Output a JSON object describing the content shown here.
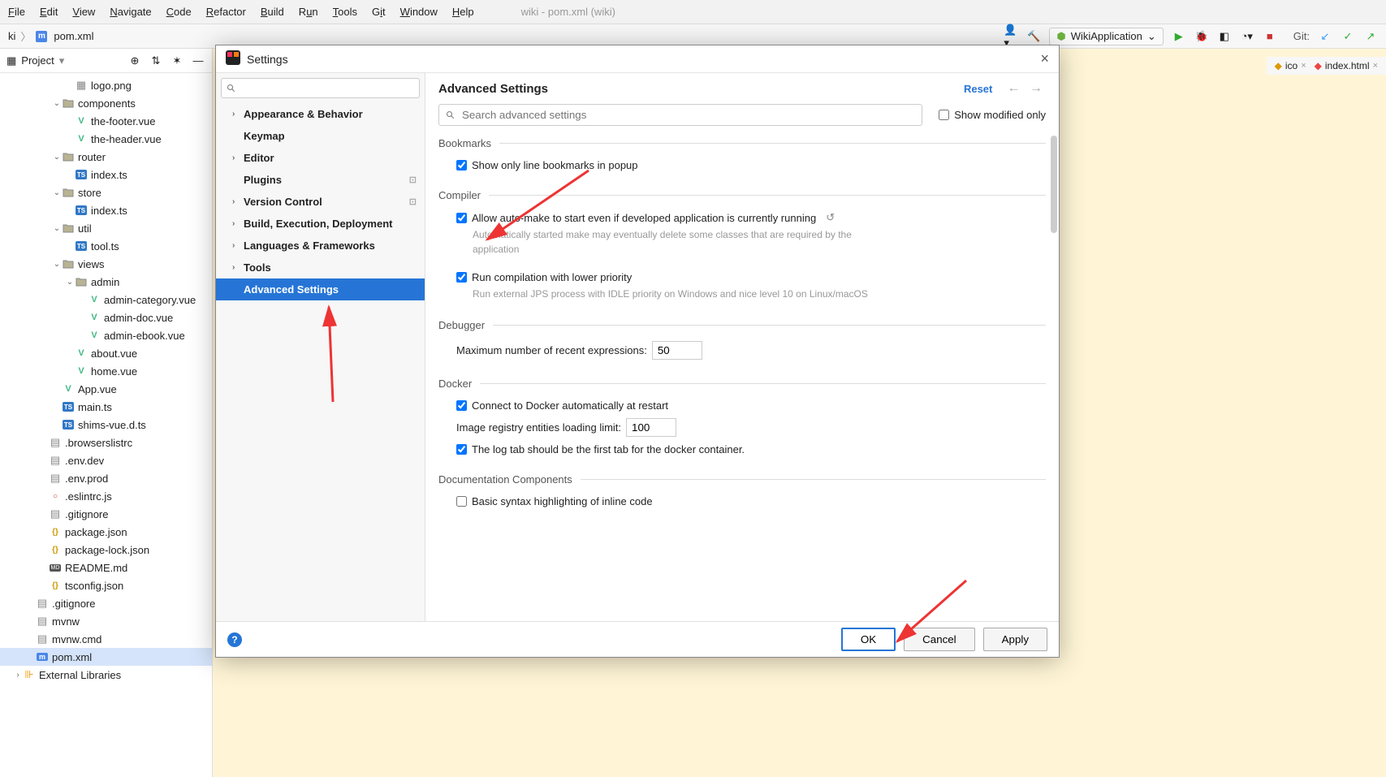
{
  "menubar": {
    "items": [
      "File",
      "Edit",
      "View",
      "Navigate",
      "Code",
      "Refactor",
      "Build",
      "Run",
      "Tools",
      "Git",
      "Window",
      "Help"
    ],
    "title_hint": "wiki - pom.xml (wiki)"
  },
  "breadcrumb": {
    "parts": [
      "ki",
      "pom.xml"
    ]
  },
  "run_config": "WikiApplication",
  "git_label": "Git:",
  "project_panel": {
    "title": "Project",
    "nodes": [
      {
        "depth": 5,
        "icon": "image",
        "label": "logo.png",
        "expand": ""
      },
      {
        "depth": 4,
        "icon": "folder",
        "label": "components",
        "expand": "v"
      },
      {
        "depth": 5,
        "icon": "vue",
        "label": "the-footer.vue",
        "expand": ""
      },
      {
        "depth": 5,
        "icon": "vue",
        "label": "the-header.vue",
        "expand": ""
      },
      {
        "depth": 4,
        "icon": "folder",
        "label": "router",
        "expand": "v"
      },
      {
        "depth": 5,
        "icon": "ts",
        "label": "index.ts",
        "expand": ""
      },
      {
        "depth": 4,
        "icon": "folder",
        "label": "store",
        "expand": "v"
      },
      {
        "depth": 5,
        "icon": "ts",
        "label": "index.ts",
        "expand": ""
      },
      {
        "depth": 4,
        "icon": "folder",
        "label": "util",
        "expand": "v"
      },
      {
        "depth": 5,
        "icon": "ts",
        "label": "tool.ts",
        "expand": ""
      },
      {
        "depth": 4,
        "icon": "folder",
        "label": "views",
        "expand": "v"
      },
      {
        "depth": 5,
        "icon": "folder",
        "label": "admin",
        "expand": "v"
      },
      {
        "depth": 6,
        "icon": "vue",
        "label": "admin-category.vue",
        "expand": ""
      },
      {
        "depth": 6,
        "icon": "vue",
        "label": "admin-doc.vue",
        "expand": ""
      },
      {
        "depth": 6,
        "icon": "vue",
        "label": "admin-ebook.vue",
        "expand": ""
      },
      {
        "depth": 5,
        "icon": "vue",
        "label": "about.vue",
        "expand": ""
      },
      {
        "depth": 5,
        "icon": "vue",
        "label": "home.vue",
        "expand": ""
      },
      {
        "depth": 4,
        "icon": "vue",
        "label": "App.vue",
        "expand": ""
      },
      {
        "depth": 4,
        "icon": "ts",
        "label": "main.ts",
        "expand": ""
      },
      {
        "depth": 4,
        "icon": "ts",
        "label": "shims-vue.d.ts",
        "expand": ""
      },
      {
        "depth": 3,
        "icon": "file",
        "label": ".browserslistrc",
        "expand": ""
      },
      {
        "depth": 3,
        "icon": "file",
        "label": ".env.dev",
        "expand": ""
      },
      {
        "depth": 3,
        "icon": "file",
        "label": ".env.prod",
        "expand": ""
      },
      {
        "depth": 3,
        "icon": "js",
        "label": ".eslintrc.js",
        "expand": ""
      },
      {
        "depth": 3,
        "icon": "file",
        "label": ".gitignore",
        "expand": ""
      },
      {
        "depth": 3,
        "icon": "json",
        "label": "package.json",
        "expand": ""
      },
      {
        "depth": 3,
        "icon": "json",
        "label": "package-lock.json",
        "expand": ""
      },
      {
        "depth": 3,
        "icon": "md",
        "label": "README.md",
        "expand": ""
      },
      {
        "depth": 3,
        "icon": "json",
        "label": "tsconfig.json",
        "expand": ""
      },
      {
        "depth": 2,
        "icon": "file",
        "label": ".gitignore",
        "expand": ""
      },
      {
        "depth": 2,
        "icon": "file",
        "label": "mvnw",
        "expand": ""
      },
      {
        "depth": 2,
        "icon": "file",
        "label": "mvnw.cmd",
        "expand": ""
      },
      {
        "depth": 2,
        "icon": "maven",
        "label": "pom.xml",
        "expand": "",
        "selected": true
      },
      {
        "depth": 1,
        "icon": "lib",
        "label": "External Libraries",
        "expand": ">"
      }
    ]
  },
  "editor_tabs": [
    {
      "icon": "ico",
      "label": "ico"
    },
    {
      "icon": "html",
      "label": "index.html"
    }
  ],
  "dialog": {
    "title": "Settings",
    "search_placeholder": "",
    "nav": [
      {
        "label": "Appearance & Behavior",
        "bold": true,
        "chev": true
      },
      {
        "label": "Keymap",
        "bold": true,
        "chev": false
      },
      {
        "label": "Editor",
        "bold": true,
        "chev": true
      },
      {
        "label": "Plugins",
        "bold": true,
        "chev": false,
        "badge": "⊡"
      },
      {
        "label": "Version Control",
        "bold": true,
        "chev": true,
        "badge": "⊡"
      },
      {
        "label": "Build, Execution, Deployment",
        "bold": true,
        "chev": true
      },
      {
        "label": "Languages & Frameworks",
        "bold": true,
        "chev": true
      },
      {
        "label": "Tools",
        "bold": true,
        "chev": true
      },
      {
        "label": "Advanced Settings",
        "bold": true,
        "chev": false,
        "selected": true
      }
    ],
    "content_title": "Advanced Settings",
    "reset": "Reset",
    "search_adv_placeholder": "Search advanced settings",
    "show_modified": "Show modified only",
    "sections": {
      "bookmarks": {
        "title": "Bookmarks",
        "opt1": "Show only line bookmarks in popup"
      },
      "compiler": {
        "title": "Compiler",
        "opt1": "Allow auto-make to start even if developed application is currently running",
        "desc1": "Automatically started make may eventually delete some classes that are required by the application",
        "opt2": "Run compilation with lower priority",
        "desc2": "Run external JPS process with IDLE priority on Windows and nice level 10 on Linux/macOS"
      },
      "debugger": {
        "title": "Debugger",
        "opt1": "Maximum number of recent expressions:",
        "val1": "50"
      },
      "docker": {
        "title": "Docker",
        "opt1": "Connect to Docker automatically at restart",
        "opt2": "Image registry entities loading limit:",
        "val2": "100",
        "opt3": "The log tab should be the first tab for the docker container."
      },
      "doc_comp": {
        "title": "Documentation Components",
        "opt1": "Basic syntax highlighting of inline code"
      }
    },
    "buttons": {
      "ok": "OK",
      "cancel": "Cancel",
      "apply": "Apply"
    }
  }
}
